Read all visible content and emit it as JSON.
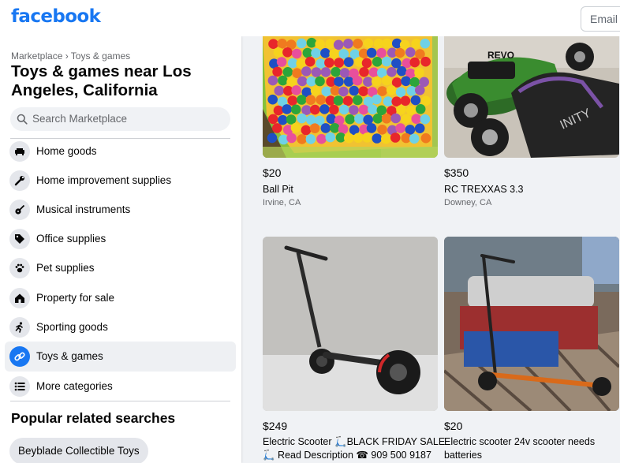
{
  "header": {
    "logo": "facebook",
    "email_placeholder": "Email or phone"
  },
  "sidebar": {
    "breadcrumb": "Marketplace › Toys & games",
    "title": "Toys & games near Los Angeles, California",
    "search_placeholder": "Search Marketplace",
    "categories": [
      {
        "label": "Home goods",
        "icon": "sofa-icon"
      },
      {
        "label": "Home improvement supplies",
        "icon": "wrench-icon"
      },
      {
        "label": "Musical instruments",
        "icon": "guitar-icon"
      },
      {
        "label": "Office supplies",
        "icon": "tag-icon"
      },
      {
        "label": "Pet supplies",
        "icon": "paw-icon"
      },
      {
        "label": "Property for sale",
        "icon": "house-icon"
      },
      {
        "label": "Sporting goods",
        "icon": "runner-icon"
      },
      {
        "label": "Toys & games",
        "icon": "link-icon",
        "selected": true
      },
      {
        "label": "More categories",
        "icon": "list-icon"
      }
    ],
    "popular_title": "Popular related searches",
    "popular_chips": [
      "Beyblade Collectible Toys"
    ]
  },
  "listings": [
    {
      "price": "$20",
      "title": "Ball Pit",
      "location": "Irvine, CA",
      "image": "ball-pit-photo"
    },
    {
      "price": "$350",
      "title": "RC TREXXAS 3.3",
      "location": "Downey, CA",
      "image": "rc-truck-photo"
    },
    {
      "price": "$249",
      "title": "Electric Scooter 🛴BLACK FRIDAY SALE",
      "title_line2": "🛴 Read Description ☎ 909 500 9187",
      "image": "scooter-photo"
    },
    {
      "price": "$20",
      "title": "Electric scooter 24v scooter needs",
      "title_line2": "batteries",
      "image": "kids-scooter-photo"
    }
  ],
  "colors": {
    "brand": "#1877f2",
    "selected_bg": "#eef0f3"
  }
}
